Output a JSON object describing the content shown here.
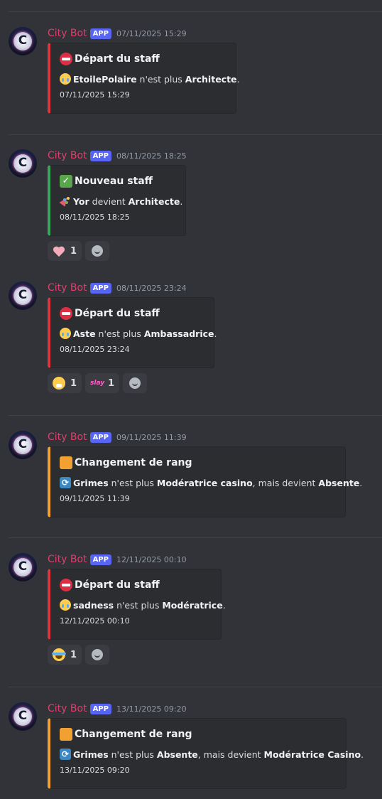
{
  "messages": [
    {
      "username": "City Bot",
      "badge": "APP",
      "timestamp": "07/11/2025 15:29",
      "embed": {
        "type": "departure",
        "title": "Départ du staff",
        "desc_parts": [
          "EtoilePolaire",
          " n'est plus ",
          "Architecte",
          "."
        ],
        "footer": "07/11/2025 15:29"
      },
      "reactions": []
    },
    {
      "username": "City Bot",
      "badge": "APP",
      "timestamp": "08/11/2025 18:25",
      "embed": {
        "type": "new",
        "title": "Nouveau staff",
        "desc_parts": [
          "Yor",
          " devient ",
          "Architecte",
          "."
        ],
        "footer": "08/11/2025 18:25"
      },
      "reactions": [
        {
          "emoji": "pink-heart",
          "count": "1"
        }
      ]
    },
    {
      "username": "City Bot",
      "badge": "APP",
      "timestamp": "08/11/2025 23:24",
      "embed": {
        "type": "departure",
        "title": "Départ du staff",
        "desc_parts": [
          "Aste",
          " n'est plus ",
          "Ambassadrice",
          "."
        ],
        "footer": "08/11/2025 23:24"
      },
      "reactions": [
        {
          "emoji": "face-with-open-mouth",
          "count": "1"
        },
        {
          "emoji": "pink-text-sticker",
          "label": "slay",
          "count": "1"
        }
      ]
    },
    {
      "username": "City Bot",
      "badge": "APP",
      "timestamp": "09/11/2025 11:39",
      "embed": {
        "type": "change",
        "title": "Changement de rang",
        "desc_parts": [
          "Grimes",
          " n'est plus ",
          "Modératrice casino",
          ", mais devient ",
          "Absente",
          "."
        ],
        "footer": "09/11/2025 11:39"
      },
      "reactions": []
    },
    {
      "username": "City Bot",
      "badge": "APP",
      "timestamp": "12/11/2025 00:10",
      "embed": {
        "type": "departure",
        "title": "Départ du staff",
        "desc_parts": [
          "sadness",
          " n'est plus ",
          "Modératrice",
          "."
        ],
        "footer": "12/11/2025 00:10"
      },
      "reactions": [
        {
          "emoji": "face-with-tears-of-joy",
          "count": "1"
        }
      ]
    },
    {
      "username": "City Bot",
      "badge": "APP",
      "timestamp": "13/11/2025 09:20",
      "embed": {
        "type": "change",
        "title": "Changement de rang",
        "desc_parts": [
          "Grimes",
          " n'est plus ",
          "Absente",
          ", mais devient ",
          "Modératrice Casino",
          "."
        ],
        "footer": "13/11/2025 09:20"
      },
      "reactions": []
    }
  ],
  "avatar_letter": "C",
  "colors": {
    "background": "#313338",
    "embed_bg": "#2b2d31",
    "username": "#e03e6b",
    "app_badge": "#5865f2",
    "departure_bar": "#da373c",
    "new_bar": "#3ba55c",
    "change_bar": "#f0a132"
  }
}
